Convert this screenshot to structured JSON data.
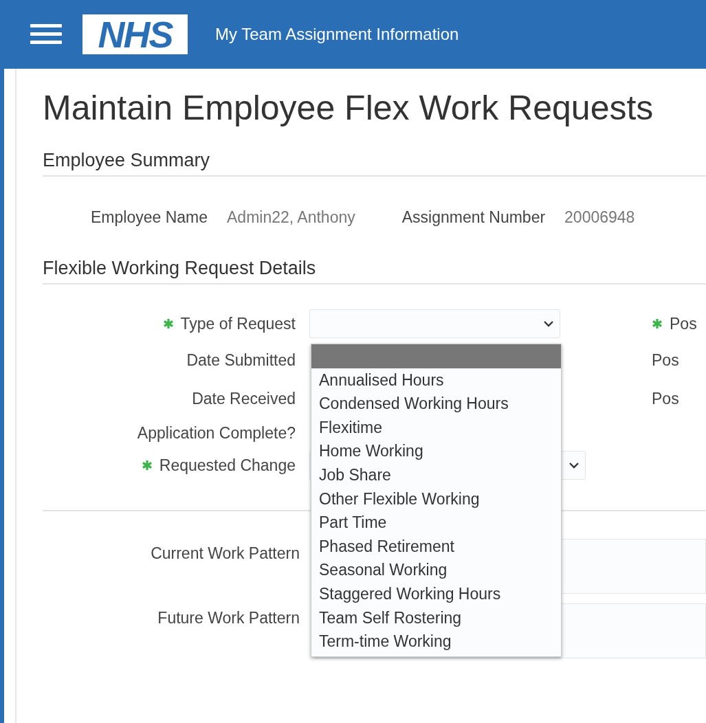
{
  "header": {
    "app_title": "My Team Assignment Information",
    "logo": "NHS"
  },
  "page_title": "Maintain Employee Flex Work Requests",
  "employee_summary": {
    "heading": "Employee Summary",
    "fields": [
      {
        "label": "Employee Name",
        "value": "Admin22, Anthony"
      },
      {
        "label": "Assignment Number",
        "value": "20006948"
      }
    ]
  },
  "request_details": {
    "heading": "Flexible Working Request Details",
    "fields": [
      {
        "label": "Type of Request",
        "required": true,
        "kind": "select"
      },
      {
        "label": "Date Submitted",
        "required": false,
        "kind": "plain"
      },
      {
        "label": "Date Received",
        "required": false,
        "kind": "plain"
      },
      {
        "label": "Application Complete?",
        "required": false,
        "kind": "plain"
      },
      {
        "label": "Requested Change",
        "required": true,
        "kind": "select"
      }
    ],
    "right_fields": [
      {
        "label": "Pos",
        "required": true
      },
      {
        "label": "Pos",
        "required": false
      },
      {
        "label": "Pos",
        "required": false
      }
    ],
    "dropdown_options": [
      {
        "selected": true
      },
      {
        "label": "Annualised Hours",
        "selected": false
      },
      {
        "label": "Condensed Working Hours",
        "selected": false
      },
      {
        "label": "Flexitime",
        "selected": false
      },
      {
        "label": "Home Working",
        "selected": false
      },
      {
        "label": "Job Share",
        "selected": false
      },
      {
        "label": "Other Flexible Working",
        "selected": false
      },
      {
        "label": "Part Time",
        "selected": false
      },
      {
        "label": "Phased Retirement",
        "selected": false
      },
      {
        "label": "Seasonal Working",
        "selected": false
      },
      {
        "label": "Staggered Working Hours",
        "selected": false
      },
      {
        "label": "Team Self Rostering",
        "selected": false
      },
      {
        "label": "Term-time Working",
        "selected": false
      }
    ]
  },
  "work_patterns": [
    {
      "label": "Current Work Pattern"
    },
    {
      "label": "Future Work Pattern"
    }
  ]
}
